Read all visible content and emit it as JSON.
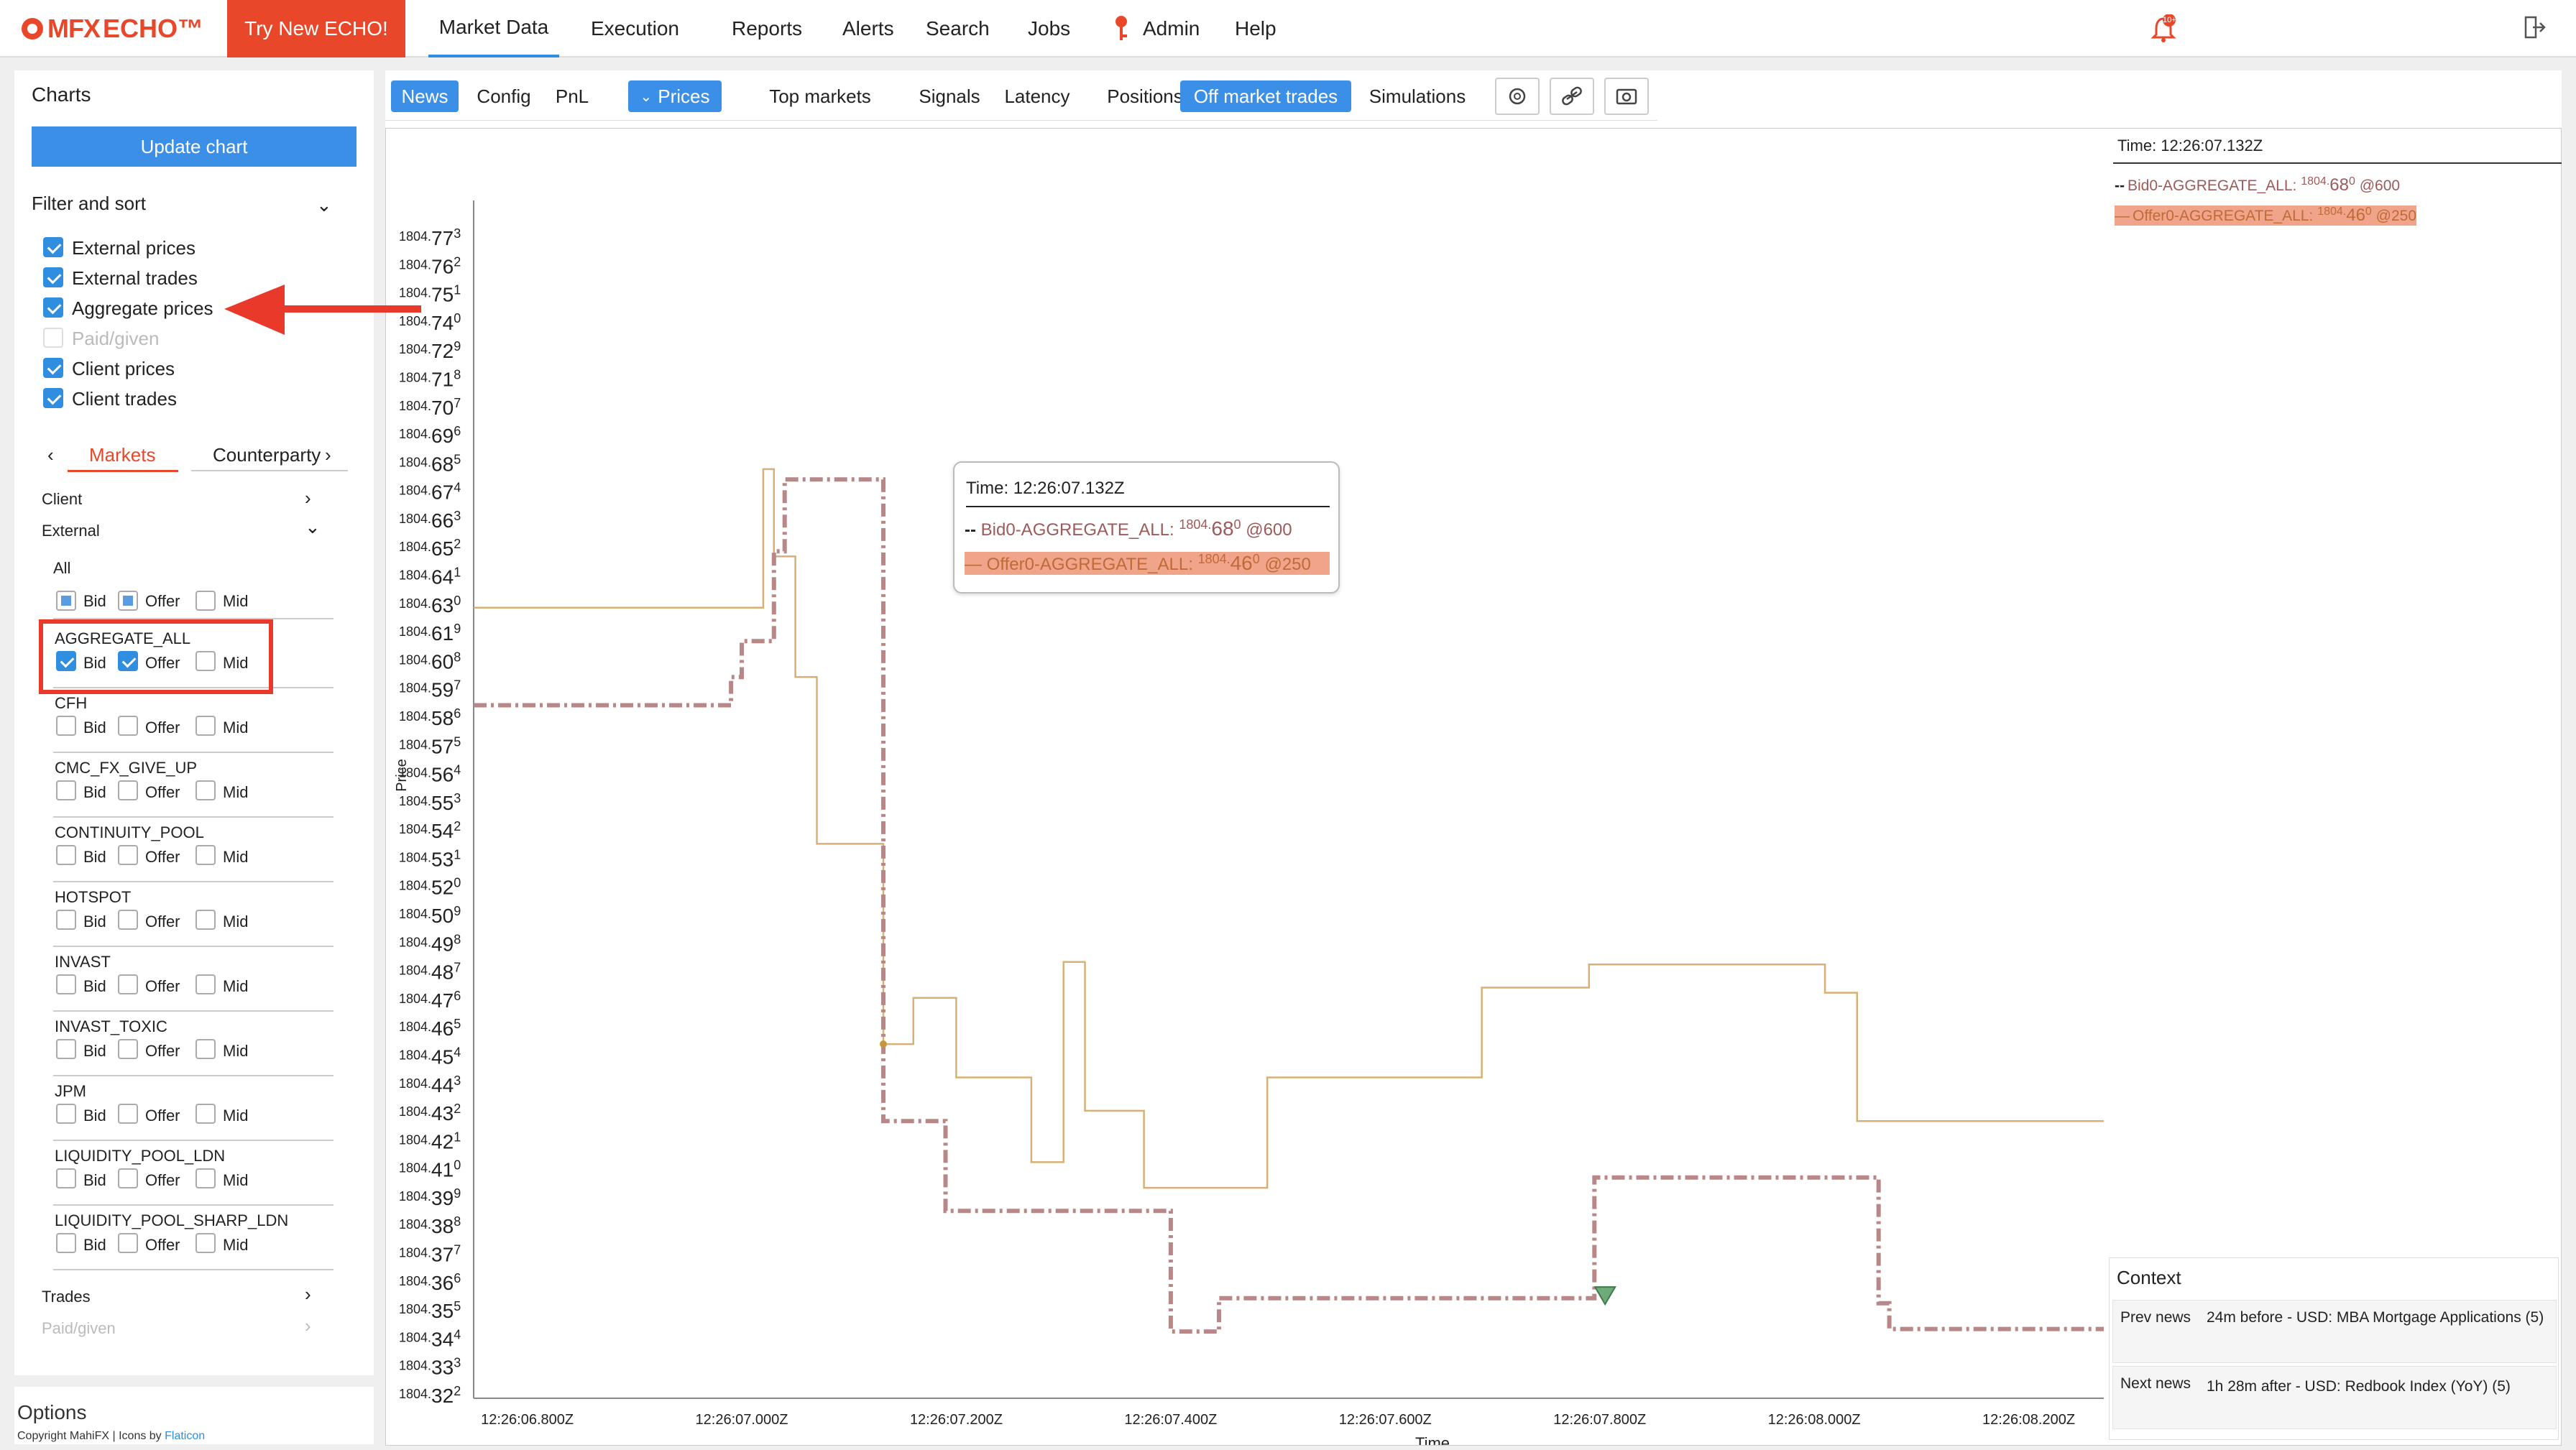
{
  "app": {
    "logo_text": "MFX",
    "logo_text2": "ECHO™",
    "try_button": "Try New ECHO!"
  },
  "nav": [
    "Market Data",
    "Execution",
    "Reports",
    "Alerts",
    "Search",
    "Jobs",
    "Admin",
    "Help"
  ],
  "notification_badge": "10+",
  "sidebar": {
    "title": "Charts",
    "update_button": "Update chart",
    "filter_label": "Filter and sort",
    "filters": [
      {
        "label": "External prices",
        "checked": true
      },
      {
        "label": "External trades",
        "checked": true
      },
      {
        "label": "Aggregate prices",
        "checked": true
      },
      {
        "label": "Paid/given",
        "checked": false,
        "disabled": true
      },
      {
        "label": "Client prices",
        "checked": true
      },
      {
        "label": "Client trades",
        "checked": true
      }
    ],
    "tabs": [
      "Markets",
      "Counterparty"
    ],
    "sections": [
      "Client",
      "External"
    ],
    "all_label": "All",
    "markets": [
      {
        "name": "AGGREGATE_ALL",
        "bid": true,
        "offer": true,
        "mid": false
      },
      {
        "name": "CFH",
        "bid": false,
        "offer": false,
        "mid": false
      },
      {
        "name": "CMC_FX_GIVE_UP",
        "bid": false,
        "offer": false,
        "mid": false
      },
      {
        "name": "CONTINUITY_POOL",
        "bid": false,
        "offer": false,
        "mid": false
      },
      {
        "name": "HOTSPOT",
        "bid": false,
        "offer": false,
        "mid": false
      },
      {
        "name": "INVAST",
        "bid": false,
        "offer": false,
        "mid": false
      },
      {
        "name": "INVAST_TOXIC",
        "bid": false,
        "offer": false,
        "mid": false
      },
      {
        "name": "JPM",
        "bid": false,
        "offer": false,
        "mid": false
      },
      {
        "name": "LIQUIDITY_POOL_LDN",
        "bid": false,
        "offer": false,
        "mid": false
      },
      {
        "name": "LIQUIDITY_POOL_SHARP_LDN",
        "bid": false,
        "offer": false,
        "mid": false
      }
    ],
    "col_labels": {
      "bid": "Bid",
      "offer": "Offer",
      "mid": "Mid"
    },
    "trades_label": "Trades",
    "paid_label": "Paid/given",
    "options_label": "Options",
    "copyright": "Copyright MahiFX | Icons by ",
    "copyright_link": "Flaticon"
  },
  "tabs": [
    {
      "label": "News",
      "selected": true
    },
    {
      "label": "Config",
      "selected": false
    },
    {
      "label": "PnL",
      "selected": false
    },
    {
      "label": "Prices",
      "selected": true
    },
    {
      "label": "Top markets",
      "selected": false
    },
    {
      "label": "Signals",
      "selected": false
    },
    {
      "label": "Latency",
      "selected": false
    },
    {
      "label": "Positions",
      "selected": false
    },
    {
      "label": "Off market trades",
      "selected": true
    },
    {
      "label": "Simulations",
      "selected": false
    }
  ],
  "legend": {
    "time": "Time: 12:26:07.132Z",
    "bid": {
      "prefix": "Bid0-AGGREGATE_ALL:",
      "small": "1804.",
      "big": "68",
      "sup": "0",
      "qty": "@600"
    },
    "offer": {
      "prefix": "Offer0-AGGREGATE_ALL:",
      "small": "1804.",
      "big": "46",
      "sup": "0",
      "qty": "@250"
    }
  },
  "tooltip": {
    "time": "Time: 12:26:07.132Z",
    "bid": {
      "prefix": "Bid0-AGGREGATE_ALL:",
      "small": "1804.",
      "big": "68",
      "sup": "0",
      "qty": "@600"
    },
    "offer": {
      "prefix": "Offer0-AGGREGATE_ALL:",
      "small": "1804.",
      "big": "46",
      "sup": "0",
      "qty": "@250"
    }
  },
  "context": {
    "title": "Context",
    "rows": [
      {
        "key": "Prev news",
        "value": "24m before - USD: MBA Mortgage Applications (5)"
      },
      {
        "key": "Next news",
        "value": "1h 28m after - USD: Redbook Index (YoY) (5)"
      }
    ]
  },
  "colors": {
    "accent": "#3c8fe6",
    "brand": "#e8472a",
    "bid": "#b98787",
    "offer": "#d7b078"
  },
  "chart_data": {
    "type": "line",
    "xlabel": "Time",
    "ylabel": "Price",
    "x_ticks": [
      "12:26:06.800Z",
      "12:26:07.000Z",
      "12:26:07.200Z",
      "12:26:07.400Z",
      "12:26:07.600Z",
      "12:26:07.800Z",
      "12:26:08.000Z",
      "12:26:08.200Z"
    ],
    "y_ticks": [
      "1804.773",
      "1804.762",
      "1804.751",
      "1804.740",
      "1804.729",
      "1804.718",
      "1804.707",
      "1804.696",
      "1804.685",
      "1804.674",
      "1804.663",
      "1804.652",
      "1804.641",
      "1804.630",
      "1804.619",
      "1804.608",
      "1804.597",
      "1804.586",
      "1804.575",
      "1804.564",
      "1804.553",
      "1804.542",
      "1804.531",
      "1804.520",
      "1804.509",
      "1804.498",
      "1804.487",
      "1804.476",
      "1804.465",
      "1804.454",
      "1804.443",
      "1804.432",
      "1804.421",
      "1804.410",
      "1804.399",
      "1804.388",
      "1804.377",
      "1804.366",
      "1804.355",
      "1804.344",
      "1804.333",
      "1804.322"
    ],
    "ylim": [
      1804.322,
      1804.773
    ],
    "xlim": [
      "12:26:06.750Z",
      "12:26:08.270Z"
    ],
    "series": [
      {
        "name": "Offer0-AGGREGATE_ALL",
        "style": "solid",
        "step": true,
        "points": [
          [
            "12:26:06.750Z",
            1804.63
          ],
          [
            "12:26:07.020Z",
            1804.63
          ],
          [
            "12:26:07.020Z",
            1804.684
          ],
          [
            "12:26:07.030Z",
            1804.684
          ],
          [
            "12:26:07.030Z",
            1804.65
          ],
          [
            "12:26:07.050Z",
            1804.65
          ],
          [
            "12:26:07.050Z",
            1804.603
          ],
          [
            "12:26:07.070Z",
            1804.603
          ],
          [
            "12:26:07.070Z",
            1804.538
          ],
          [
            "12:26:07.132Z",
            1804.538
          ],
          [
            "12:26:07.132Z",
            1804.46
          ],
          [
            "12:26:07.160Z",
            1804.46
          ],
          [
            "12:26:07.160Z",
            1804.478
          ],
          [
            "12:26:07.200Z",
            1804.478
          ],
          [
            "12:26:07.200Z",
            1804.447
          ],
          [
            "12:26:07.270Z",
            1804.447
          ],
          [
            "12:26:07.270Z",
            1804.414
          ],
          [
            "12:26:07.300Z",
            1804.414
          ],
          [
            "12:26:07.300Z",
            1804.492
          ],
          [
            "12:26:07.320Z",
            1804.492
          ],
          [
            "12:26:07.320Z",
            1804.434
          ],
          [
            "12:26:07.375Z",
            1804.434
          ],
          [
            "12:26:07.375Z",
            1804.404
          ],
          [
            "12:26:07.490Z",
            1804.404
          ],
          [
            "12:26:07.490Z",
            1804.447
          ],
          [
            "12:26:07.690Z",
            1804.447
          ],
          [
            "12:26:07.690Z",
            1804.482
          ],
          [
            "12:26:07.790Z",
            1804.482
          ],
          [
            "12:26:07.790Z",
            1804.491
          ],
          [
            "12:26:08.010Z",
            1804.491
          ],
          [
            "12:26:08.010Z",
            1804.48
          ],
          [
            "12:26:08.040Z",
            1804.48
          ],
          [
            "12:26:08.040Z",
            1804.43
          ],
          [
            "12:26:08.270Z",
            1804.43
          ]
        ]
      },
      {
        "name": "Bid0-AGGREGATE_ALL",
        "style": "dashed",
        "step": true,
        "points": [
          [
            "12:26:06.750Z",
            1804.592
          ],
          [
            "12:26:06.990Z",
            1804.592
          ],
          [
            "12:26:06.990Z",
            1804.603
          ],
          [
            "12:26:07.000Z",
            1804.603
          ],
          [
            "12:26:07.000Z",
            1804.617
          ],
          [
            "12:26:07.030Z",
            1804.617
          ],
          [
            "12:26:07.030Z",
            1804.652
          ],
          [
            "12:26:07.040Z",
            1804.652
          ],
          [
            "12:26:07.040Z",
            1804.68
          ],
          [
            "12:26:07.132Z",
            1804.68
          ],
          [
            "12:26:07.132Z",
            1804.43
          ],
          [
            "12:26:07.190Z",
            1804.43
          ],
          [
            "12:26:07.190Z",
            1804.395
          ],
          [
            "12:26:07.400Z",
            1804.395
          ],
          [
            "12:26:07.400Z",
            1804.348
          ],
          [
            "12:26:07.445Z",
            1804.348
          ],
          [
            "12:26:07.445Z",
            1804.361
          ],
          [
            "12:26:07.795Z",
            1804.361
          ],
          [
            "12:26:07.795Z",
            1804.408
          ],
          [
            "12:26:08.060Z",
            1804.408
          ],
          [
            "12:26:08.060Z",
            1804.359
          ],
          [
            "12:26:08.070Z",
            1804.359
          ],
          [
            "12:26:08.070Z",
            1804.349
          ],
          [
            "12:26:08.270Z",
            1804.349
          ]
        ]
      }
    ],
    "markers": [
      {
        "type": "triangle-down",
        "x": "12:26:07.805Z",
        "y": 1804.362
      }
    ]
  }
}
